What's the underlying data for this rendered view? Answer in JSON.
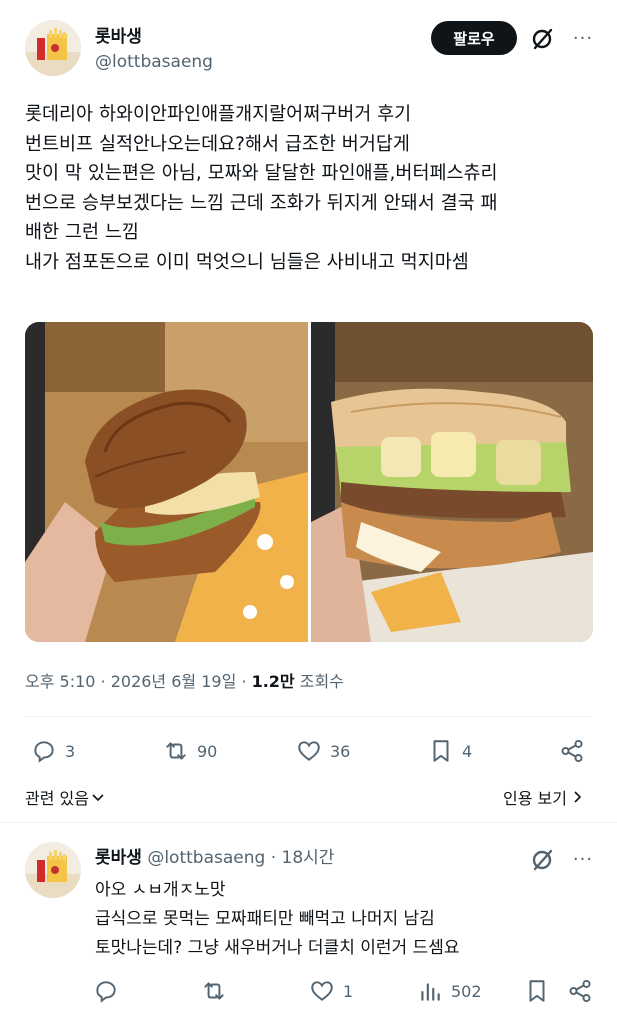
{
  "post": {
    "author_name": "롯바생",
    "author_handle": "@lottbasaeng",
    "follow_label": "팔로우",
    "more_label": "···",
    "text_lines": [
      "롯데리아 하와이안파인애플개지랄어쩌구버거 후기",
      "번트비프 실적안나오는데요?해서 급조한 버거답게",
      "맛이 막 있는편은 아님, 모짜와 달달한 파인애플,버터페스츄리",
      "번으로 승부보겠다는 느낌 근데 조화가 뒤지게 안돼서 결국 패",
      "배한 그런 느낌",
      "내가 점포돈으로 이미 먹엇으니 님들은 사비내고 먹지마셈"
    ],
    "timestamp": "오후 5:10 · 2026년 6월 19일 · ",
    "views_count": "1.2만",
    "views_label": " 조회수",
    "replies": "3",
    "reposts": "90",
    "likes": "36",
    "bookmarks": "4",
    "related_label": "관련 있음",
    "quote_label": "인용 보기"
  },
  "reply": {
    "author_name": "롯바생",
    "author_handle": "@lottbasaeng",
    "time": "· 18시간",
    "more_label": "···",
    "text_lines": [
      "아오 ㅅㅂ개ㅈ노맛",
      "급식으로 못먹는 모짜패티만 빼먹고 나머지 남김",
      "토맛나는데? 그냥 새우버거나 더클치 이런거 드셈요"
    ],
    "replies": "",
    "reposts": "",
    "likes": "1",
    "views": "502"
  }
}
